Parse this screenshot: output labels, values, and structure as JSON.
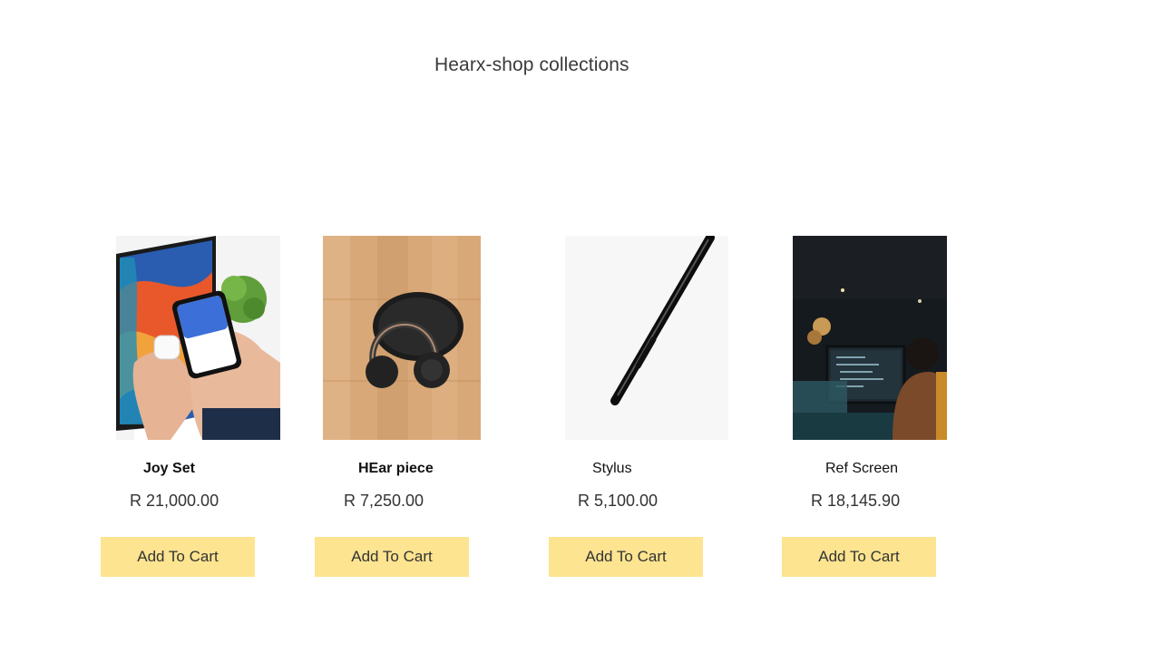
{
  "page": {
    "heading": "Hearx-shop collections"
  },
  "products": [
    {
      "name": "Joy Set",
      "price": "R 21,000.00",
      "button_label": "Add To Cart",
      "image": "phone-and-earbuds-photo"
    },
    {
      "name": "HEar piece",
      "price": "R 7,250.00",
      "button_label": "Add To Cart",
      "image": "headphones-on-wood-photo"
    },
    {
      "name": "Stylus",
      "price": "R 5,100.00",
      "button_label": "Add To Cart",
      "image": "black-stylus-photo"
    },
    {
      "name": "Ref Screen",
      "price": "R 18,145.90",
      "button_label": "Add To Cart",
      "image": "developer-at-monitor-photo"
    }
  ],
  "colors": {
    "button_bg": "#fde490",
    "text": "#333333"
  }
}
